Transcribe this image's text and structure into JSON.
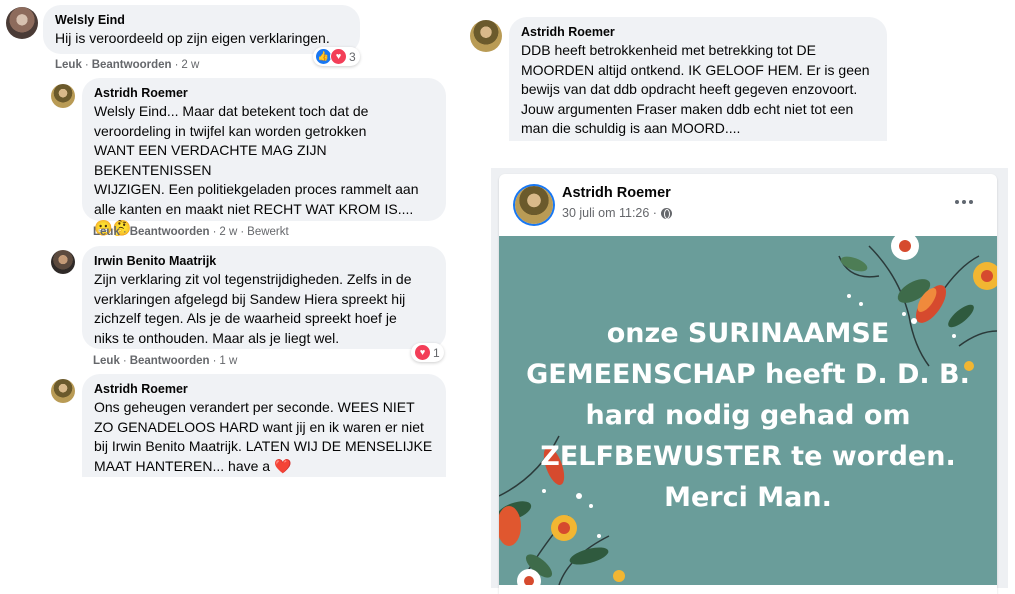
{
  "comments_left": [
    {
      "author": "Welsly Eind",
      "lines": [
        "Hij is veroordeeld op zijn eigen verklaringen."
      ],
      "actions": {
        "like": "Leuk",
        "reply": "Beantwoorden",
        "time": "2 w",
        "edited": ""
      },
      "reactions": {
        "icons": [
          "like",
          "love"
        ],
        "count": "3"
      }
    },
    {
      "author": "Astridh Roemer",
      "lines": [
        "Welsly Eind... Maar dat betekent toch dat de",
        "veroordeling in twijfel kan worden getrokken",
        "WANT EEN VERDACHTE MAG ZIJN BEKENTENISSEN",
        "WIJZIGEN. Een politiekgeladen proces rammelt aan",
        "alle kanten en maakt niet RECHT WAT KROM IS...."
      ],
      "emoji_line": "😬🤔",
      "actions": {
        "like": "Leuk",
        "reply": "Beantwoorden",
        "time": "2 w",
        "edited": "Bewerkt"
      }
    },
    {
      "author": "Irwin Benito Maatrijk",
      "lines": [
        "Zijn verklaring zit vol tegenstrijdigheden. Zelfs in de",
        "verklaringen afgelegd bij Sandew Hiera spreekt hij",
        "zichzelf tegen. Als je de waarheid spreekt hoef je",
        "niks te onthouden. Maar als je liegt wel."
      ],
      "actions": {
        "like": "Leuk",
        "reply": "Beantwoorden",
        "time": "1 w",
        "edited": ""
      },
      "reactions": {
        "icons": [
          "love"
        ],
        "count": "1"
      }
    },
    {
      "author": "Astridh Roemer",
      "lines": [
        "Ons geheugen verandert per seconde. WEES NIET",
        "ZO GENADELOOS HARD want jij en ik waren er niet",
        "bij Irwin Benito Maatrijk. LATEN WIJ DE MENSELIJKE",
        "MAAT HANTEREN... have a ❤️"
      ]
    }
  ],
  "comment_right": {
    "author": "Astridh Roemer",
    "lines": [
      "DDB heeft betrokkenheid met betrekking tot DE",
      "MOORDEN altijd ontkend. IK GELOOF HEM. Er is geen",
      "bewijs van dat ddb opdracht heeft gegeven enzovoort.",
      "Jouw argumenten Fraser maken ddb echt niet tot een",
      "man die schuldig is aan MOORD...."
    ]
  },
  "post": {
    "author": "Astridh Roemer",
    "date": "30 juli om 11:26 ·",
    "privacy_icon": "globe-icon",
    "more_icon": "more-options-icon",
    "image_text": [
      "onze SURINAAMSE",
      "GEMEENSCHAP heeft D. D. B.",
      "hard nodig gehad om",
      "ZELFBEWUSTER te worden.",
      "Merci Man."
    ],
    "image_bg_color": "#6a9d9a"
  },
  "colors": {
    "like_blue": "#1877f2",
    "love_red": "#f33e58",
    "bubble_gray": "#f0f2f5",
    "meta_gray": "#65676b"
  }
}
